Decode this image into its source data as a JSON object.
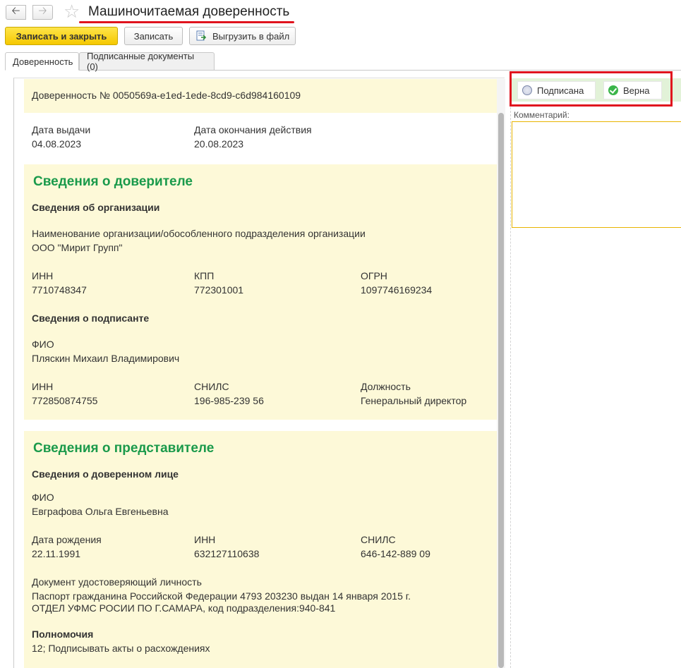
{
  "window": {
    "title": "Машиночитаемая доверенность"
  },
  "toolbar": {
    "save_close": "Записать и закрыть",
    "save": "Записать",
    "export": "Выгрузить в файл"
  },
  "tabs": [
    {
      "label": "Доверенность",
      "active": true
    },
    {
      "label": "Подписанные документы (0)",
      "active": false
    }
  ],
  "doc": {
    "header": "Доверенность № 0050569a-e1ed-1ede-8cd9-c6d984160109",
    "issue_date_label": "Дата выдачи",
    "issue_date": "04.08.2023",
    "end_date_label": "Дата окончания действия",
    "end_date": "20.08.2023"
  },
  "principal": {
    "title": "Сведения о доверителе",
    "org_section": "Сведения об организации",
    "org_name_label": "Наименование организации/обособленного подразделения организации",
    "org_name": "ООО \"Мирит Групп\"",
    "inn_label": "ИНН",
    "inn": "7710748347",
    "kpp_label": "КПП",
    "kpp": "772301001",
    "ogrn_label": "ОГРН",
    "ogrn": "1097746169234",
    "signer_section": "Сведения о подписанте",
    "fio_label": "ФИО",
    "fio": "Пляскин Михаил Владимирович",
    "signer_inn_label": "ИНН",
    "signer_inn": "772850874755",
    "snils_label": "СНИЛС",
    "snils": "196-985-239 56",
    "position_label": "Должность",
    "position": "Генеральный директор"
  },
  "representative": {
    "title": "Сведения о представителе",
    "person_section": "Сведения о доверенном лице",
    "fio_label": "ФИО",
    "fio": "Евграфова Ольга Евгеньевна",
    "birth_label": "Дата рождения",
    "birth": "22.11.1991",
    "inn_label": "ИНН",
    "inn": "632127110638",
    "snils_label": "СНИЛС",
    "snils": "646-142-889 09",
    "id_doc_label": "Документ удостоверяющий личность",
    "id_doc_line1": "Паспорт гражданина Российской Федерации 4793 203230 выдан 14 января 2015 г.",
    "id_doc_line2": "ОТДЕЛ УФМС РОСИИ ПО Г.САМАРА, код подразделения:940-841",
    "powers_section": "Полномочия",
    "powers": "12; Подписывать акты о расхождениях"
  },
  "status": {
    "signed": "Подписана",
    "valid": "Верна",
    "comment_label": "Комментарий:",
    "comment": ""
  },
  "colors": {
    "accent_yellow": "#f5c800",
    "section_green": "#1a9a4b",
    "highlight_red": "#e0141e",
    "panel_bg": "#fdf9d8"
  }
}
